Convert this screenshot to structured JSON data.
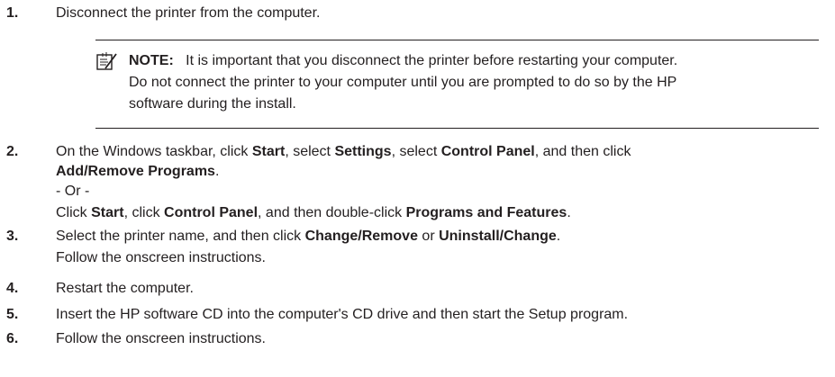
{
  "steps": [
    {
      "num": "1.",
      "text": "Disconnect the printer from the computer."
    },
    {
      "num": "2.",
      "line1": [
        "On the Windows taskbar, click ",
        "Start",
        ", select ",
        "Settings",
        ", select ",
        "Control Panel",
        ", and then click"
      ],
      "line2": [
        "Add/Remove Programs",
        "."
      ],
      "or": "- Or -",
      "line3": [
        "Click ",
        "Start",
        ", click ",
        "Control Panel",
        ", and then double-click ",
        "Programs and Features",
        "."
      ]
    },
    {
      "num": "3.",
      "line1": [
        "Select the printer name, and then click ",
        "Change/Remove",
        " or ",
        "Uninstall/Change",
        "."
      ],
      "line2": "Follow the onscreen instructions."
    },
    {
      "num": "4.",
      "text": "Restart the computer."
    },
    {
      "num": "5.",
      "text": "Insert the HP software CD into the computer's CD drive and then start the Setup program."
    },
    {
      "num": "6.",
      "text": "Follow the onscreen instructions."
    }
  ],
  "note": {
    "label": "NOTE:",
    "text1": "It is important that you disconnect the printer before restarting your computer.",
    "text2": "Do not connect the printer to your computer until you are prompted to do so by the HP",
    "text3": "software during the install.",
    "icon": "note-icon"
  }
}
